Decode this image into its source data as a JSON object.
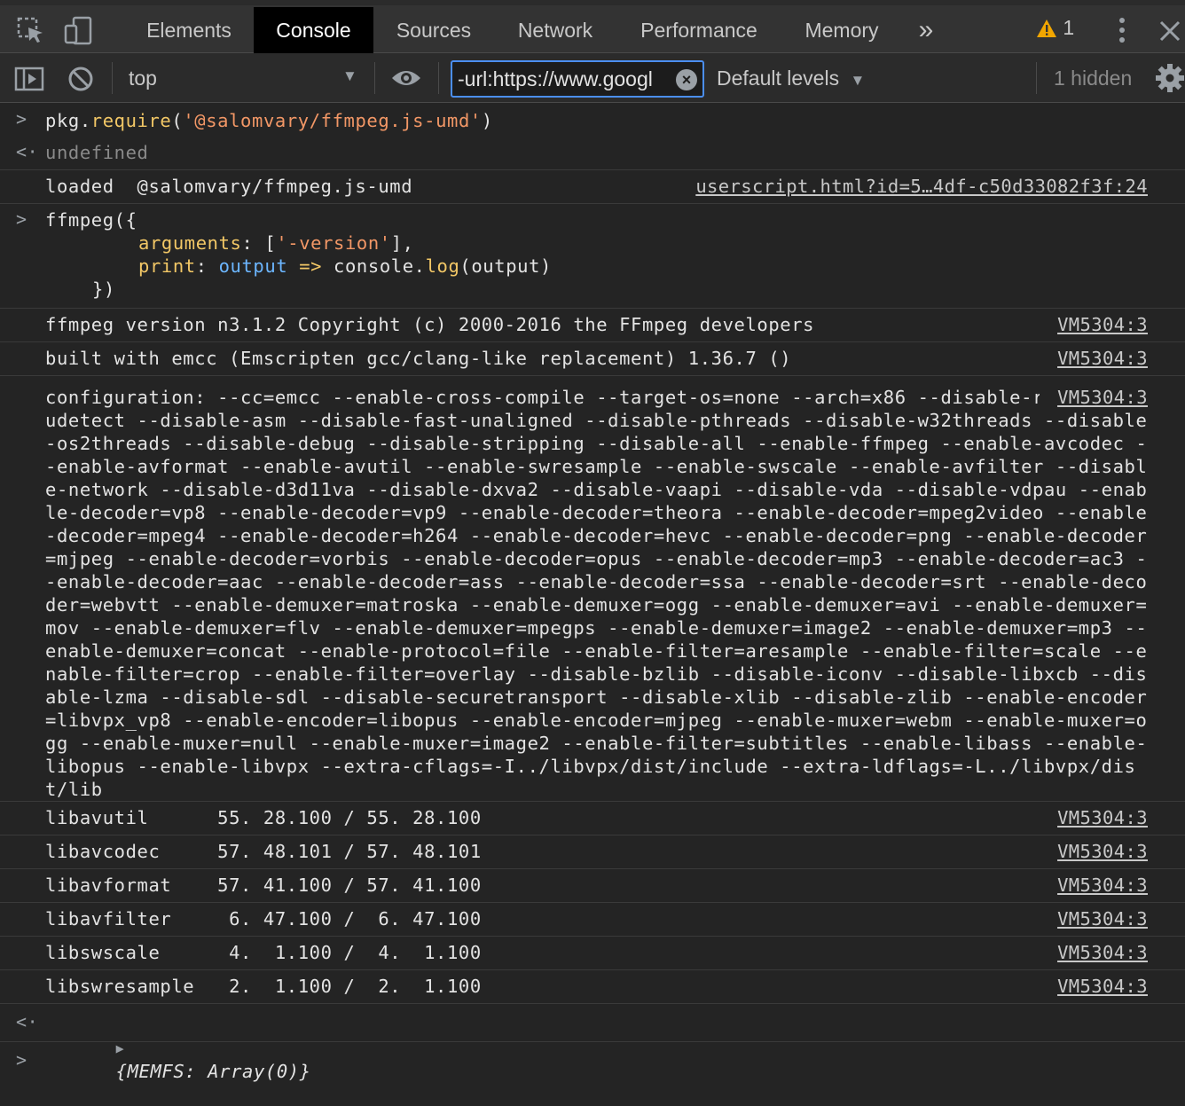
{
  "tabs": [
    "Elements",
    "Console",
    "Sources",
    "Network",
    "Performance",
    "Memory"
  ],
  "overflow_label": "»",
  "warning_count": "1",
  "context_select": "top",
  "filter_value": "-url:https://www.googl",
  "levels_label": "Default levels",
  "hidden_label": "1 hidden",
  "entries": {
    "e1_code_a": "pkg.",
    "e1_code_b": "require",
    "e1_code_c": "(",
    "e1_code_d": "'@salomvary/ffmpeg.js-umd'",
    "e1_code_e": ")",
    "e2_result": "undefined",
    "e3_text": "loaded  @salomvary/ffmpeg.js-umd",
    "e3_src": "userscript.html?id=5…4df-c50d33082f3f:24",
    "e4_l1": "ffmpeg({",
    "e4_l2_key": "arguments",
    "e4_l2_mid": ": [",
    "e4_l2_str": "'-version'",
    "e4_l2_end": "],",
    "e4_l3_key": "print",
    "e4_l3_mid": ": ",
    "e4_l3_param": "output",
    "e4_l3_arrow": " => ",
    "e4_l3_console": "console.",
    "e4_l3_log": "log",
    "e4_l3_end": "(output)",
    "e4_l4": "})",
    "e5_text": "ffmpeg version n3.1.2 Copyright (c) 2000-2016 the FFmpeg developers",
    "e6_text": "built with emcc (Emscripten gcc/clang-like replacement) 1.36.7 ()",
    "e7_text": "configuration: --cc=emcc --enable-cross-compile --target-os=none --arch=x86 --disable-runtime-cpudetect --disable-asm --disable-fast-unaligned --disable-pthreads --disable-w32threads --disable-os2threads --disable-debug --disable-stripping --disable-all --enable-ffmpeg --enable-avcodec --enable-avformat --enable-avutil --enable-swresample --enable-swscale --enable-avfilter --disable-network --disable-d3d11va --disable-dxva2 --disable-vaapi --disable-vda --disable-vdpau --enable-decoder=vp8 --enable-decoder=vp9 --enable-decoder=theora --enable-decoder=mpeg2video --enable-decoder=mpeg4 --enable-decoder=h264 --enable-decoder=hevc --enable-decoder=png --enable-decoder=mjpeg --enable-decoder=vorbis --enable-decoder=opus --enable-decoder=mp3 --enable-decoder=ac3 --enable-decoder=aac --enable-decoder=ass --enable-decoder=ssa --enable-decoder=srt --enable-decoder=webvtt --enable-demuxer=matroska --enable-demuxer=ogg --enable-demuxer=avi --enable-demuxer=mov --enable-demuxer=flv --enable-demuxer=mpegps --enable-demuxer=image2 --enable-demuxer=mp3 --enable-demuxer=concat --enable-protocol=file --enable-filter=aresample --enable-filter=scale --enable-filter=crop --enable-filter=overlay --disable-bzlib --disable-iconv --disable-libxcb --disable-lzma --disable-sdl --disable-securetransport --disable-xlib --disable-zlib --enable-encoder=libvpx_vp8 --enable-encoder=libopus --enable-encoder=mjpeg --enable-muxer=webm --enable-muxer=ogg --enable-muxer=null --enable-muxer=image2 --enable-filter=subtitles --enable-libass --enable-libopus --enable-libvpx --extra-cflags=-I../libvpx/dist/include --extra-ldflags=-L../libvpx/dist/lib",
    "lib_rows": [
      "libavutil      55. 28.100 / 55. 28.100",
      "libavcodec     57. 48.101 / 57. 48.101",
      "libavformat    57. 41.100 / 57. 41.100",
      "libavfilter     6. 47.100 /  6. 47.100",
      "libswscale      4.  1.100 /  4.  1.100",
      "libswresample   2.  1.100 /  2.  1.100"
    ],
    "vm_src": "VM5304:3",
    "final_result": "{MEMFS: Array(0)}"
  }
}
